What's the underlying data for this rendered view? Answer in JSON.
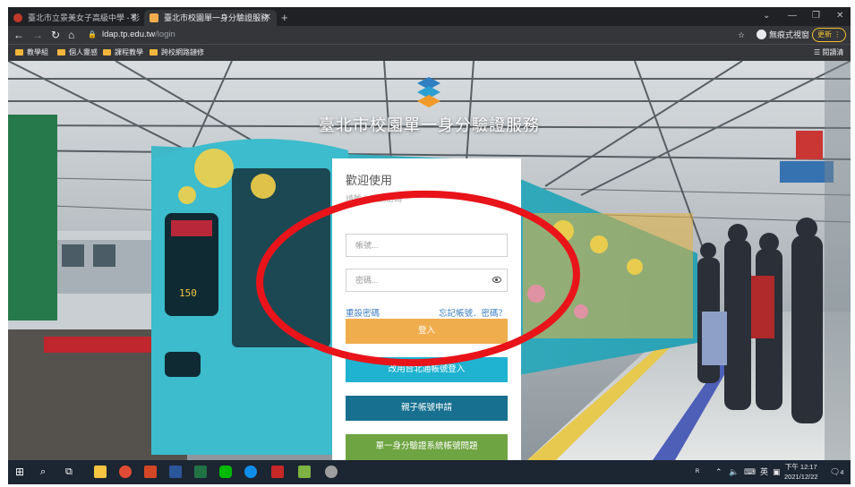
{
  "browser": {
    "tabs": [
      {
        "title": "臺北市立景美女子高級中學 - 影",
        "active": false,
        "favicon_color": "#c0392b"
      },
      {
        "title": "臺北市校園單一身分驗證服務",
        "active": true,
        "favicon_color": "#f0ad4e"
      }
    ],
    "url_host": "ldap.tp.edu.tw",
    "url_path": "/login",
    "incognito_label": "無痕式視窗",
    "update_label": "更新",
    "bookmarks": [
      "教學組",
      "個人靈感",
      "課程教學",
      "跨校網路鏈修"
    ],
    "reading_list_label": "閱讀清單"
  },
  "page": {
    "site_title": "臺北市校園單一身分驗證服務",
    "signboard_text": "150",
    "login_card": {
      "welcome": "歡迎使用",
      "hint": "請輸入帳號密碼",
      "account_placeholder": "帳號...",
      "password_placeholder": "密碼...",
      "reset_password_link": "重設密碼",
      "forgot_link": "忘記帳號．密碼？",
      "login_button": "登入",
      "taipei_login_button": "改用台北通帳號登入",
      "parent_account_button": "親子帳號申請",
      "sso_issue_button": "單一身分驗證系統帳號問題"
    },
    "annotation_color": "#e8141a"
  },
  "taskbar": {
    "clock_period_time": "下午 12:17",
    "date": "2021/12/22",
    "ime_label": "英",
    "notification_count": "4"
  }
}
